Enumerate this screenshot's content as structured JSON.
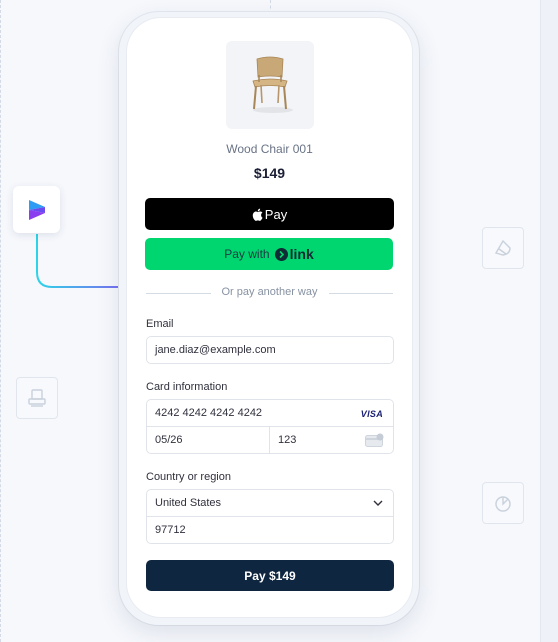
{
  "product": {
    "name": "Wood Chair 001",
    "price": "$149"
  },
  "wallets": {
    "apple_pay_label": "Pay",
    "link_prefix": "Pay with",
    "link_word": "link"
  },
  "divider": {
    "text": "Or pay another way"
  },
  "email": {
    "label": "Email",
    "value": "jane.diaz@example.com"
  },
  "card": {
    "label": "Card information",
    "number": "4242 4242 4242 4242",
    "brand": "VISA",
    "expiry": "05/26",
    "cvc": "123"
  },
  "address": {
    "label": "Country or region",
    "country": "United States",
    "zip": "97712"
  },
  "pay_button": {
    "label": "Pay $149"
  },
  "colors": {
    "apple_pay": "#000000",
    "link": "#00d66f",
    "pay_button": "#0f2640",
    "visa": "#1a1f71"
  },
  "icons": [
    "brand-logo-icon",
    "chair-image",
    "apple-icon",
    "link-arrow-icon",
    "card-chevron-icon",
    "cvc-card-icon",
    "side-tile-icons"
  ]
}
